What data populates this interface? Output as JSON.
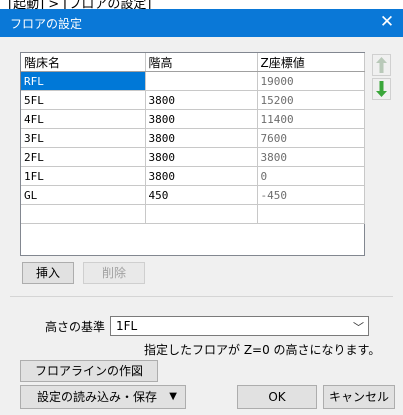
{
  "outer_title": "[起動] > [フロアの設定]",
  "window": {
    "title": "フロアの設定",
    "close_glyph": "✕"
  },
  "grid": {
    "columns": [
      "階床名",
      "階高",
      "Z座標値"
    ],
    "rows": [
      {
        "name": "RFL",
        "height": "",
        "z": "19000"
      },
      {
        "name": "5FL",
        "height": "3800",
        "z": "15200"
      },
      {
        "name": "4FL",
        "height": "3800",
        "z": "11400"
      },
      {
        "name": "3FL",
        "height": "3800",
        "z": "7600"
      },
      {
        "name": "2FL",
        "height": "3800",
        "z": "3800"
      },
      {
        "name": "1FL",
        "height": "3800",
        "z": "0"
      },
      {
        "name": "GL",
        "height": "450",
        "z": "-450"
      },
      {
        "name": "",
        "height": "",
        "z": ""
      }
    ]
  },
  "side_buttons": {
    "up_icon": "arrow-up-icon",
    "down_icon": "arrow-down-icon",
    "up_color": "#b9c9b9",
    "down_color": "#3aa63a"
  },
  "buttons": {
    "insert": "挿入",
    "delete": "削除",
    "floorline": "フロアラインの作図",
    "load_save": "設定の読み込み・保存",
    "ok": "OK",
    "cancel": "キャンセル"
  },
  "height_base": {
    "label": "高さの基準",
    "value": "1FL",
    "note": "指定したフロアが Z=0 の高さになります。"
  },
  "colors": {
    "titlebar": "#0a78d7",
    "selected_cell": "#0078d7"
  }
}
